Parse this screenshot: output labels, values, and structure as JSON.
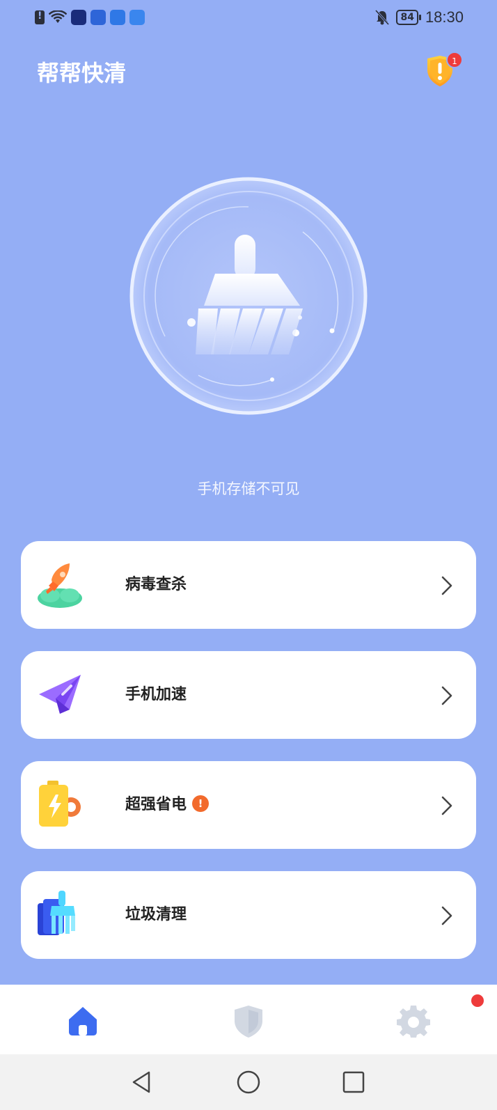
{
  "status_bar": {
    "battery": "84",
    "time": "18:30"
  },
  "header": {
    "title": "帮帮快清",
    "alert_count": "1"
  },
  "hero": {
    "caption": "手机存储不可见"
  },
  "features": [
    {
      "label": "病毒查杀",
      "icon": "rocket-icon",
      "warning": false
    },
    {
      "label": "手机加速",
      "icon": "paper-plane-icon",
      "warning": false
    },
    {
      "label": "超强省电",
      "icon": "battery-icon",
      "warning": true,
      "warning_text": "!"
    },
    {
      "label": "垃圾清理",
      "icon": "broom-icon",
      "warning": false
    }
  ],
  "bottom_nav": {
    "items": [
      "home-icon",
      "shield-icon",
      "gear-icon"
    ],
    "active": "home-icon"
  },
  "colors": {
    "background": "#94aef5",
    "card": "#ffffff",
    "active_nav": "#3d6cf0",
    "inactive_nav": "#d2d8e2",
    "warning": "#f26a2c",
    "badge": "#ee3b3b"
  }
}
